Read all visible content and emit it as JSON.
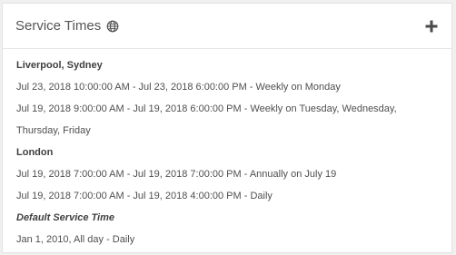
{
  "panel": {
    "title": "Service Times",
    "globe_icon": "globe-icon",
    "add_icon": "plus-icon"
  },
  "groups": [
    {
      "title": "Liverpool, Sydney",
      "entries": [
        "Jul 23, 2018 10:00:00 AM - Jul 23, 2018 6:00:00 PM - Weekly on Monday",
        "Jul 19, 2018 9:00:00 AM - Jul 19, 2018 6:00:00 PM - Weekly on Tuesday, Wednesday, Thursday, Friday"
      ]
    },
    {
      "title": "London",
      "entries": [
        "Jul 19, 2018 7:00:00 AM - Jul 19, 2018 7:00:00 PM - Annually on July 19",
        "Jul 19, 2018 7:00:00 AM - Jul 19, 2018 4:00:00 PM - Daily"
      ]
    },
    {
      "title": "Default Service Time",
      "entries": [
        "Jan 1, 2010, All day - Daily"
      ]
    }
  ]
}
